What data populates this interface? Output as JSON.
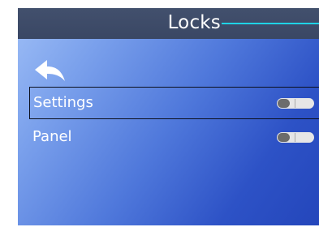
{
  "header": {
    "title": "Locks"
  },
  "navigation": {
    "back_icon": "back-arrow-icon"
  },
  "menu": {
    "items": [
      {
        "label": "Settings",
        "selected": true,
        "toggle_on": false
      },
      {
        "label": "Panel",
        "selected": false,
        "toggle_on": false
      }
    ]
  },
  "colors": {
    "header_bg": "#3d4a67",
    "accent_line": "#1fd3e6",
    "background_light": "#9ebef6",
    "background_dark": "#2446bb",
    "toggle_track": "#e6e6e6",
    "toggle_knob": "#6c6c6c"
  }
}
